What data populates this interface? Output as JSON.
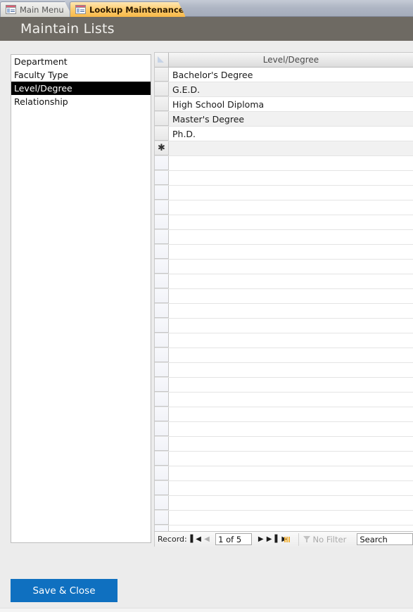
{
  "tabs": [
    {
      "label": "Main Menu",
      "icon": "form-table-icon",
      "active": false
    },
    {
      "label": "Lookup Maintenance",
      "icon": "form-table-icon",
      "active": true
    }
  ],
  "header": {
    "title": "Maintain Lists",
    "background_color": "#6E6A63"
  },
  "list_panel": {
    "name": "lookup-list",
    "items": [
      {
        "label": "Department",
        "selected": false
      },
      {
        "label": "Faculty Type",
        "selected": false
      },
      {
        "label": "Level/Degree",
        "selected": true
      },
      {
        "label": "Relationship",
        "selected": false
      }
    ],
    "selected_value": "Level/Degree",
    "selection_bg": "#000000",
    "selection_fg": "#FFFFFF"
  },
  "datasheet": {
    "column_header": "Level/Degree",
    "select_all_corner": "select-all-corner",
    "rows": [
      {
        "value": "Bachelor's Degree",
        "marker": ""
      },
      {
        "value": "G.E.D.",
        "marker": ""
      },
      {
        "value": "High School Diploma",
        "marker": ""
      },
      {
        "value": "Master's Degree",
        "marker": ""
      },
      {
        "value": "Ph.D.",
        "marker": ""
      }
    ],
    "new_record_row": {
      "value": "",
      "marker": "✱"
    },
    "empty_row_count": 26
  },
  "navigation": {
    "label": "Record:",
    "first_button": "▌◀",
    "previous_button": "◀",
    "position_text": "1 of 5",
    "next_button": "▶",
    "last_button": "▶▐",
    "new_button": "▶",
    "filter_label": "No Filter",
    "filter_icon": "funnel-icon",
    "filter_disabled": true,
    "search_value": "Search"
  },
  "footer": {
    "save_close_label": "Save & Close",
    "save_close_color": "#0F70C0"
  }
}
